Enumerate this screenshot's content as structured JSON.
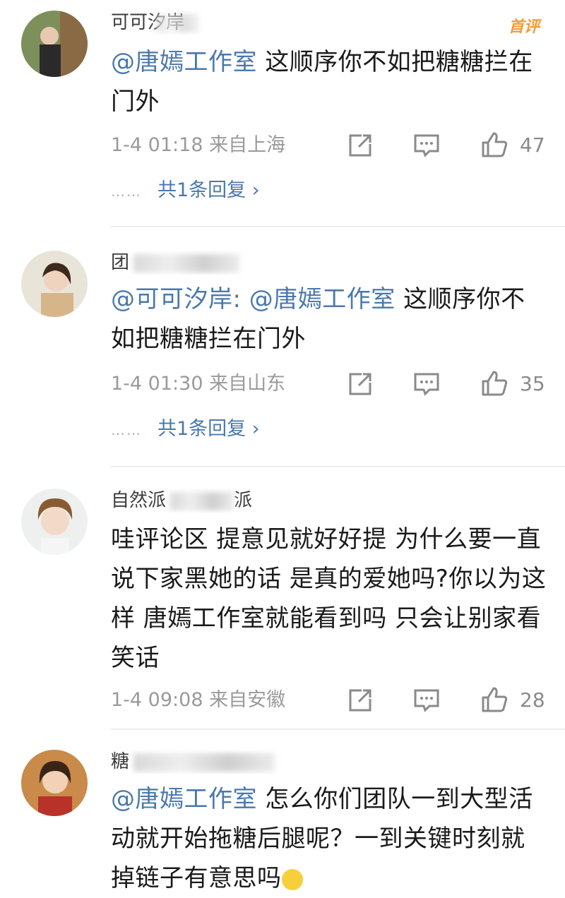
{
  "comments": [
    {
      "username": "可可汐岸",
      "badge": "首评",
      "mention": "@唐嫣工作室",
      "text": " 这顺序你不如把糖糖拦在门外",
      "time": "1-4 01:18",
      "location": "来自上海",
      "likes": "47",
      "replies_dots": "……",
      "replies_label": "共1条回复",
      "replies_chevron": "›"
    },
    {
      "username": "团",
      "mention": "@可可汐岸: @唐嫣工作室",
      "text": " 这顺序你不如把糖糖拦在门外",
      "time": "1-4 01:30",
      "location": "来自山东",
      "likes": "35",
      "replies_dots": "……",
      "replies_label": "共1条回复",
      "replies_chevron": "›"
    },
    {
      "username": "自然派",
      "username_suffix": "派",
      "text": "哇评论区 提意见就好好提 为什么要一直说下家黑她的话 是真的爱她吗?你以为这样 唐嫣工作室就能看到吗 只会让别家看笑话",
      "time": "1-4 09:08",
      "location": "来自安徽",
      "likes": "28"
    },
    {
      "username": "糖",
      "mention": "@唐嫣工作室",
      "text": " 怎么你们团队一到大型活动就开始拖糖后腿呢？一到关键时刻就掉链子有意思吗"
    }
  ],
  "icons": {
    "share": "share-icon",
    "comment": "comment-icon",
    "like": "thumbs-up-icon"
  },
  "colors": {
    "mention": "#4a78ad",
    "badge": "#f39c3a",
    "meta": "#9a9a9a"
  }
}
